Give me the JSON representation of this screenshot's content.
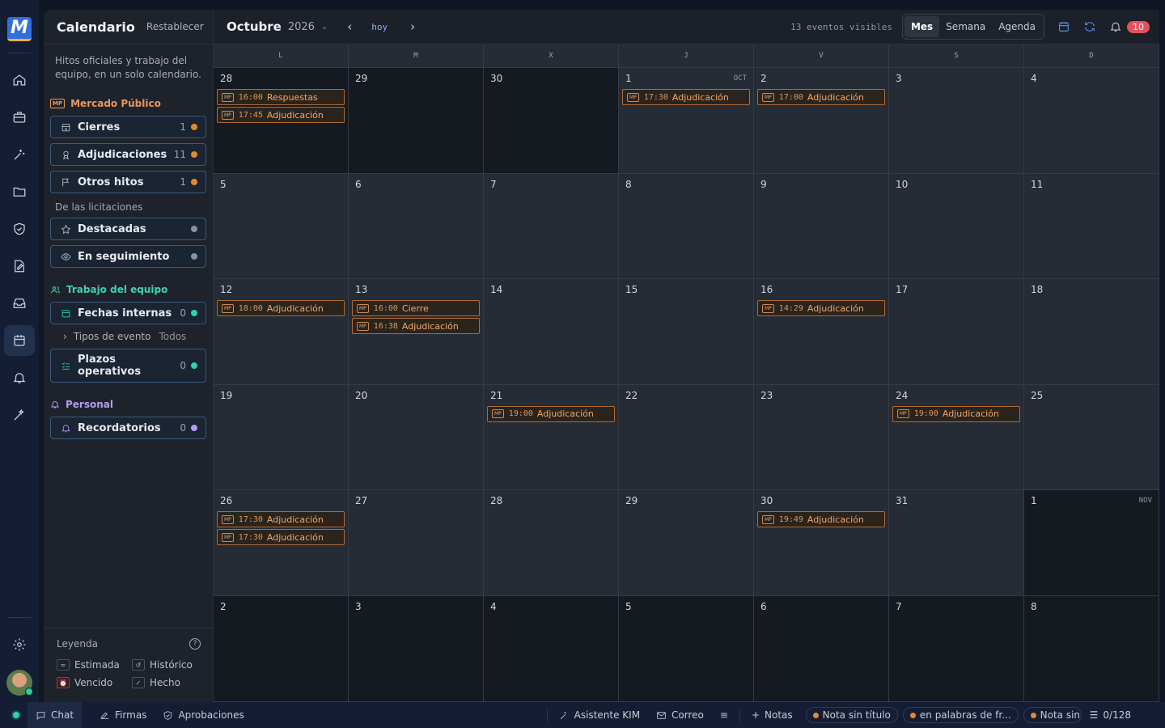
{
  "app": {
    "logo_text": "M",
    "accent": "#2f6fe0"
  },
  "rail": {
    "items": [
      "home-icon",
      "briefcase-icon",
      "sparkle-wand-icon",
      "folder-icon",
      "shield-check-icon",
      "edit-document-icon",
      "inbox-icon",
      "calendar-icon",
      "bell-icon",
      "magic-wand-icon",
      "settings-icon"
    ]
  },
  "sidebar": {
    "title": "Calendario",
    "reset_label": "Restablecer",
    "description": "Hitos oficiales y trabajo del equipo, en un solo calendario.",
    "section_mp": {
      "title": "Mercado Público",
      "badge": "MP"
    },
    "mp_filters": [
      {
        "label": "Cierres",
        "count": "1",
        "color": "#e38a2f"
      },
      {
        "label": "Adjudicaciones",
        "count": "11",
        "color": "#e38a2f"
      },
      {
        "label": "Otros hitos",
        "count": "1",
        "color": "#e38a2f"
      }
    ],
    "licit_label": "De las licitaciones",
    "licit_filters": [
      {
        "label": "Destacadas",
        "color": "#8a919c"
      },
      {
        "label": "En seguimiento",
        "color": "#8a919c"
      }
    ],
    "section_team": {
      "title": "Trabajo del equipo"
    },
    "team_internal": {
      "label": "Fechas internas",
      "count": "0",
      "color": "#2ed1b0"
    },
    "event_types": {
      "label": "Tipos de evento",
      "value": "Todos"
    },
    "team_ops": {
      "label": "Plazos operativos",
      "count": "0",
      "color": "#2ed1b0"
    },
    "section_personal": {
      "title": "Personal"
    },
    "reminders": {
      "label": "Recordatorios",
      "count": "0",
      "color": "#b39cf0"
    },
    "legend": {
      "title": "Leyenda",
      "items": [
        "Estimada",
        "Histórico",
        "Vencido",
        "Hecho"
      ]
    }
  },
  "toolbar": {
    "month": "Octubre",
    "year": "2026",
    "today_label": "hoy",
    "visible_count": "13 eventos visibles",
    "views": [
      "Mes",
      "Semana",
      "Agenda"
    ],
    "active_view": "Mes",
    "notifications": "10"
  },
  "calendar": {
    "weekdays": [
      "L",
      "M",
      "X",
      "J",
      "V",
      "S",
      "D"
    ],
    "days": [
      {
        "n": "28",
        "out": true,
        "events": [
          {
            "time": "16:00",
            "title": "Respuestas"
          },
          {
            "time": "17:45",
            "title": "Adjudicación"
          }
        ]
      },
      {
        "n": "29",
        "out": true,
        "events": []
      },
      {
        "n": "30",
        "out": true,
        "events": []
      },
      {
        "n": "1",
        "tag": "OCT",
        "events": [
          {
            "time": "17:30",
            "title": "Adjudicación"
          }
        ]
      },
      {
        "n": "2",
        "events": [
          {
            "time": "17:00",
            "title": "Adjudicación"
          }
        ]
      },
      {
        "n": "3",
        "events": []
      },
      {
        "n": "4",
        "events": []
      },
      {
        "n": "5",
        "events": []
      },
      {
        "n": "6",
        "events": []
      },
      {
        "n": "7",
        "events": []
      },
      {
        "n": "8",
        "events": []
      },
      {
        "n": "9",
        "events": []
      },
      {
        "n": "10",
        "events": []
      },
      {
        "n": "11",
        "events": []
      },
      {
        "n": "12",
        "events": [
          {
            "time": "18:00",
            "title": "Adjudicación"
          }
        ]
      },
      {
        "n": "13",
        "events": [
          {
            "time": "16:00",
            "title": "Cierre"
          },
          {
            "time": "16:38",
            "title": "Adjudicación"
          }
        ]
      },
      {
        "n": "14",
        "events": []
      },
      {
        "n": "15",
        "events": []
      },
      {
        "n": "16",
        "events": [
          {
            "time": "14:29",
            "title": "Adjudicación"
          }
        ]
      },
      {
        "n": "17",
        "events": []
      },
      {
        "n": "18",
        "events": []
      },
      {
        "n": "19",
        "events": []
      },
      {
        "n": "20",
        "events": []
      },
      {
        "n": "21",
        "events": [
          {
            "time": "19:00",
            "title": "Adjudicación"
          }
        ]
      },
      {
        "n": "22",
        "events": []
      },
      {
        "n": "23",
        "events": []
      },
      {
        "n": "24",
        "events": [
          {
            "time": "19:00",
            "title": "Adjudicación"
          }
        ]
      },
      {
        "n": "25",
        "events": []
      },
      {
        "n": "26",
        "events": [
          {
            "time": "17:30",
            "title": "Adjudicación"
          },
          {
            "time": "17:30",
            "title": "Adjudicación"
          }
        ]
      },
      {
        "n": "27",
        "events": []
      },
      {
        "n": "28",
        "events": []
      },
      {
        "n": "29",
        "events": []
      },
      {
        "n": "30",
        "events": [
          {
            "time": "19:49",
            "title": "Adjudicación"
          }
        ]
      },
      {
        "n": "31",
        "events": []
      },
      {
        "n": "1",
        "tag": "NOV",
        "out": true,
        "events": []
      },
      {
        "n": "2",
        "out": true,
        "events": []
      },
      {
        "n": "3",
        "out": true,
        "events": []
      },
      {
        "n": "4",
        "out": true,
        "events": []
      },
      {
        "n": "5",
        "out": true,
        "events": []
      },
      {
        "n": "6",
        "out": true,
        "events": []
      },
      {
        "n": "7",
        "out": true,
        "events": []
      },
      {
        "n": "8",
        "out": true,
        "events": []
      }
    ],
    "event_badge": "MP"
  },
  "statusbar": {
    "chat": "Chat",
    "firmas": "Firmas",
    "aprobaciones": "Aprobaciones",
    "asistente": "Asistente KIM",
    "correo": "Correo",
    "notas": "Notas",
    "notes": [
      "Nota sin título",
      "en palabras de fr...",
      "Nota sin"
    ],
    "counter": "0/128"
  }
}
